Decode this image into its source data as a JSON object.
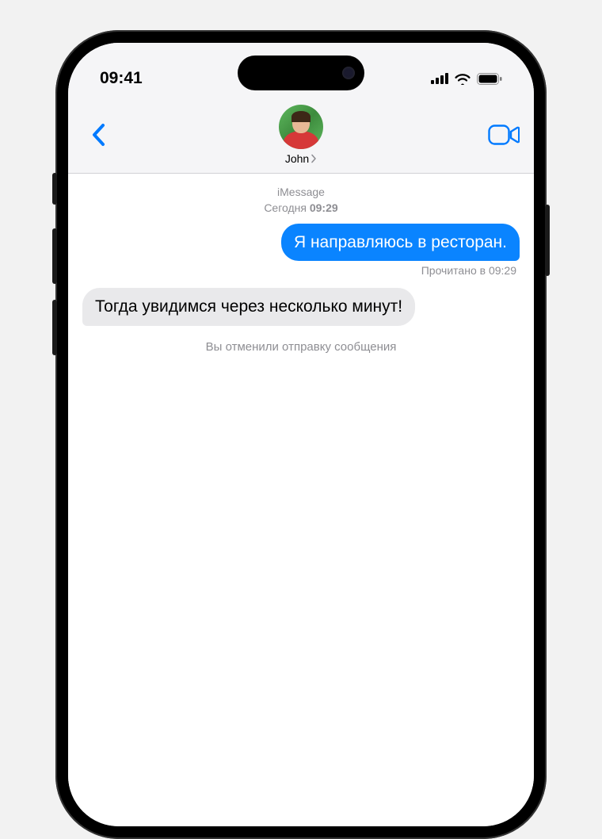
{
  "status_bar": {
    "time": "09:41"
  },
  "header": {
    "contact_name": "John"
  },
  "thread": {
    "service_label": "iMessage",
    "timestamp_prefix": "Сегодня",
    "timestamp_time": "09:29",
    "messages": [
      {
        "direction": "outgoing",
        "text": "Я направляюсь в ресторан."
      },
      {
        "direction": "incoming",
        "text": "Тогда увидимся через несколько минут!"
      }
    ],
    "read_receipt": "Прочитано в 09:29",
    "unsend_notice": "Вы отменили отправку сообщения"
  }
}
